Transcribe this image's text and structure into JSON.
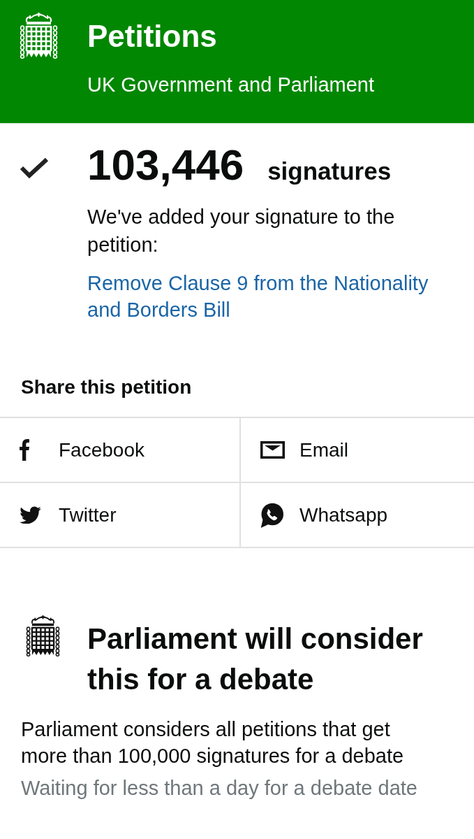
{
  "header": {
    "title": "Petitions",
    "subtitle": "UK Government and Parliament"
  },
  "confirmation": {
    "count": "103,446",
    "count_label": "signatures",
    "message": "We've added your signature to the petition:",
    "petition_link": "Remove Clause 9 from the Nationality and Borders Bill"
  },
  "share": {
    "heading": "Share this petition",
    "options": [
      {
        "kind": "facebook",
        "label": "Facebook"
      },
      {
        "kind": "email",
        "label": "Email"
      },
      {
        "kind": "twitter",
        "label": "Twitter"
      },
      {
        "kind": "whatsapp",
        "label": "Whatsapp"
      }
    ]
  },
  "debate": {
    "heading": "Parliament will consider this for a debate",
    "description": "Parliament considers all petitions that get more than 100,000 signatures for a debate",
    "status": "Waiting for less than a day for a debate date"
  }
}
